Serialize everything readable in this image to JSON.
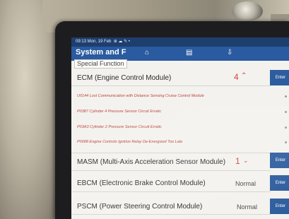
{
  "status_bar": {
    "text": "09:13 Mon, 19 Feb"
  },
  "header": {
    "title": "System and F",
    "home_icon": "home-icon",
    "report_icon": "report-icon",
    "save_icon": "save-icon"
  },
  "subtitle": "Special Function",
  "ecm": {
    "label": "ECM (Engine Control Module)",
    "count": "4",
    "enter": "Enter",
    "dtcs": [
      "U0144 Lost Communication with Distance Sensing Cruise Control Module",
      "P0387 Cylinder 4 Pressure Sensor Circuit Erratic",
      "P03A3 Cylinder 2 Pressure Sensor Circuit Erratic",
      "P0688 Engine Controls Ignition Relay De-Energized Too Late"
    ]
  },
  "masm": {
    "label": "MASM (Multi-Axis Acceleration Sensor Module)",
    "count": "1",
    "enter": "Enter"
  },
  "ebcm": {
    "label": "EBCM (Electronic Brake Control Module)",
    "status": "Normal",
    "enter": "Enter"
  },
  "pscm": {
    "label": "PSCM (Power Steering Control Module)",
    "status": "Normal",
    "enter": "Enter"
  },
  "colors": {
    "header": "#2a5aa0",
    "statusbar": "#1e3e6e",
    "dtc": "#c0443e",
    "enter": "#2d5d9e"
  }
}
